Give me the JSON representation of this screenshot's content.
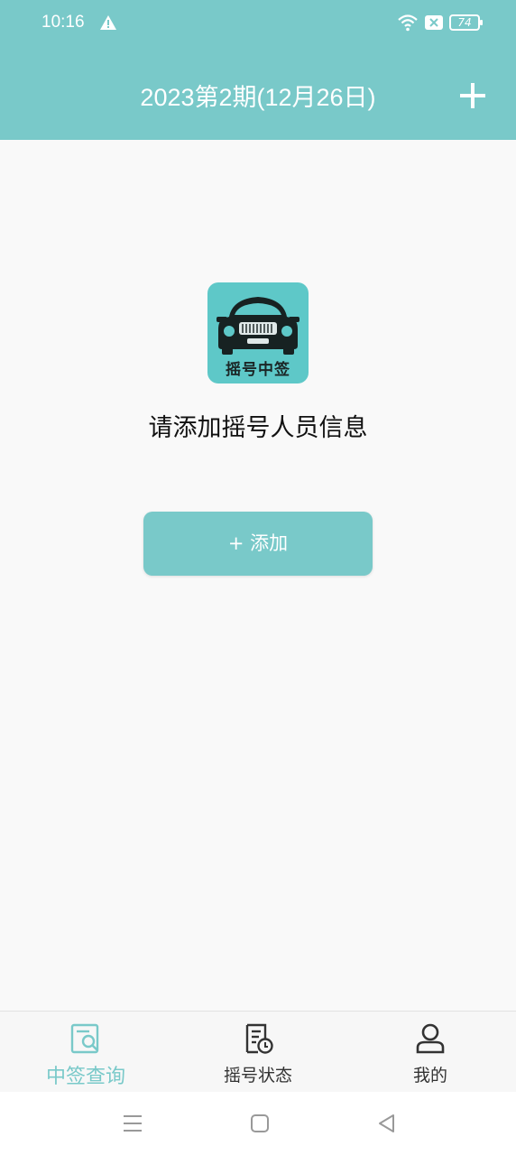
{
  "status": {
    "time": "10:16",
    "battery": "74"
  },
  "header": {
    "title": "2023第2期(12月26日)"
  },
  "empty": {
    "logo_text": "摇号中签",
    "message": "请添加摇号人员信息",
    "add_button": "+ 添加"
  },
  "tabs": [
    {
      "label": "中签查询",
      "icon": "search-document-icon",
      "active": true
    },
    {
      "label": "摇号状态",
      "icon": "document-clock-icon",
      "active": false
    },
    {
      "label": "我的",
      "icon": "person-icon",
      "active": false
    }
  ],
  "colors": {
    "accent": "#79c9c9",
    "logo_bg": "#5ec8c8",
    "background": "#f9f9f9"
  }
}
